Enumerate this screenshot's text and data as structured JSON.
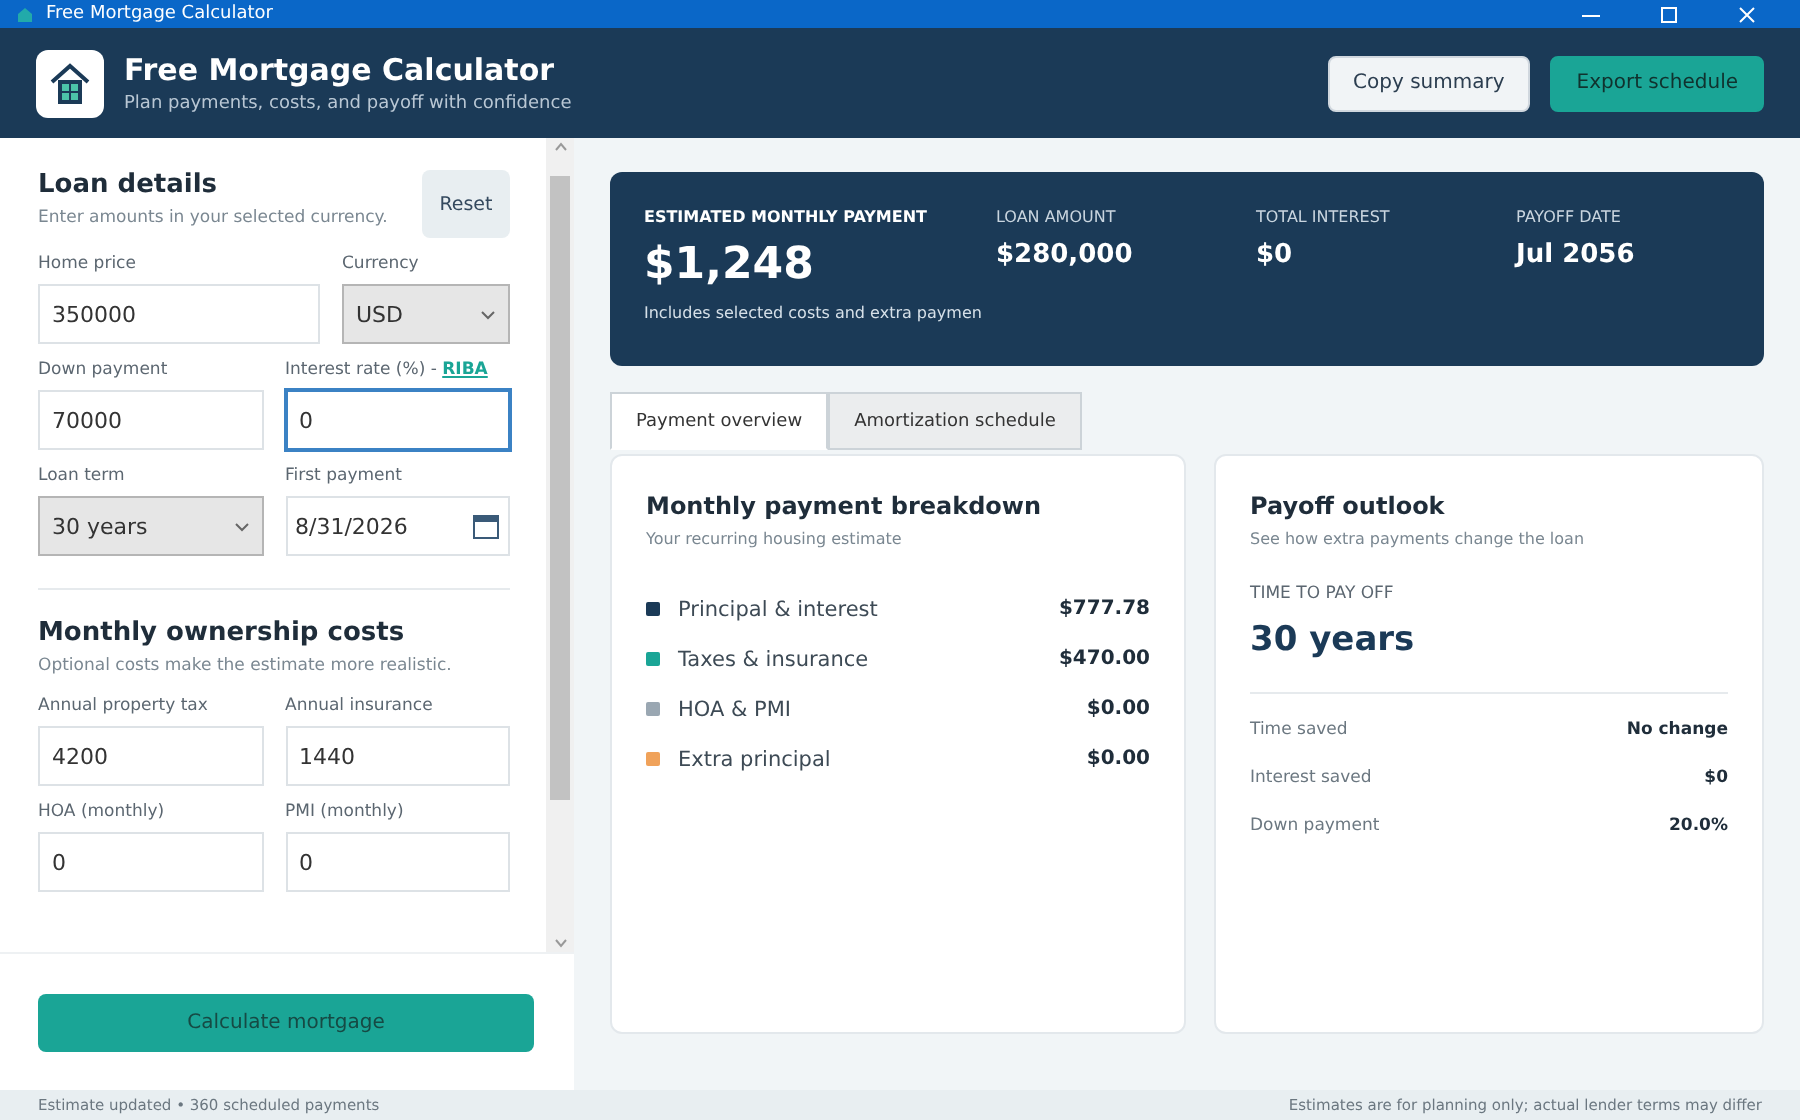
{
  "window": {
    "title": "Free Mortgage Calculator"
  },
  "header": {
    "title": "Free Mortgage Calculator",
    "subtitle": "Plan payments, costs, and payoff with confidence",
    "buttons": [
      {
        "label": "Copy summary",
        "kind": "secondary"
      },
      {
        "label": "Export schedule",
        "kind": "primary"
      }
    ]
  },
  "loan_details": {
    "title": "Loan details",
    "subtitle": "Enter amounts in your selected currency.",
    "reset": "Reset",
    "fields": [
      {
        "label": "Home price",
        "kind": "input",
        "value": "350000",
        "focused": false
      },
      {
        "label": "Currency",
        "kind": "select",
        "value": "USD",
        "focused": false
      },
      {
        "label": "Down payment",
        "kind": "input",
        "value": "70000",
        "focused": false
      },
      {
        "label": "Interest rate (%) - ",
        "link": "RIBA",
        "kind": "input",
        "value": "0",
        "focused": true
      },
      {
        "label": "Loan term",
        "kind": "select",
        "value": "30 years",
        "focused": false
      },
      {
        "label": "First payment",
        "kind": "date",
        "value": "8/31/2026",
        "focused": false
      }
    ]
  },
  "ownership_costs": {
    "title": "Monthly ownership costs",
    "subtitle": "Optional costs make the estimate more realistic.",
    "fields": [
      {
        "label": "Annual property tax",
        "kind": "input",
        "value": "4200",
        "focused": false
      },
      {
        "label": "Annual insurance",
        "kind": "input",
        "value": "1440",
        "focused": false
      },
      {
        "label": "HOA (monthly)",
        "kind": "input",
        "value": "0",
        "focused": false
      },
      {
        "label": "PMI (monthly)",
        "kind": "input",
        "value": "0",
        "focused": false
      }
    ]
  },
  "calculate_button": "Calculate mortgage",
  "summary": {
    "main": {
      "label": "ESTIMATED MONTHLY PAYMENT",
      "value": "$1,248",
      "note": "Includes selected costs and extra paymen"
    },
    "stats": [
      {
        "label": "LOAN AMOUNT",
        "value": "$280,000"
      },
      {
        "label": "TOTAL INTEREST",
        "value": "$0"
      },
      {
        "label": "PAYOFF DATE",
        "value": "Jul 2056"
      }
    ]
  },
  "tabs": [
    {
      "label": "Payment overview",
      "selected": true
    },
    {
      "label": "Amortization schedule",
      "selected": false
    }
  ],
  "breakdown": {
    "title": "Monthly payment breakdown",
    "subtitle": "Your recurring housing estimate",
    "items": [
      {
        "label": "Principal & interest",
        "value": "$777.78",
        "color": "#1b3a57"
      },
      {
        "label": "Taxes & insurance",
        "value": "$470.00",
        "color": "#1aa596"
      },
      {
        "label": "HOA & PMI",
        "value": "$0.00",
        "color": "#9aa7b2"
      },
      {
        "label": "Extra principal",
        "value": "$0.00",
        "color": "#f0a25a"
      }
    ]
  },
  "payoff": {
    "title": "Payoff outlook",
    "subtitle": "See how extra payments change the loan",
    "time_label": "TIME TO PAY OFF",
    "time_value": "30 years",
    "rows": [
      {
        "label": "Time saved",
        "value": "No change"
      },
      {
        "label": "Interest saved",
        "value": "$0"
      },
      {
        "label": "Down payment",
        "value": "20.0%"
      }
    ]
  },
  "status_bar": {
    "left": "Estimate updated • 360 scheduled payments",
    "right": "Estimates are for planning only; actual lender terms may differ"
  }
}
